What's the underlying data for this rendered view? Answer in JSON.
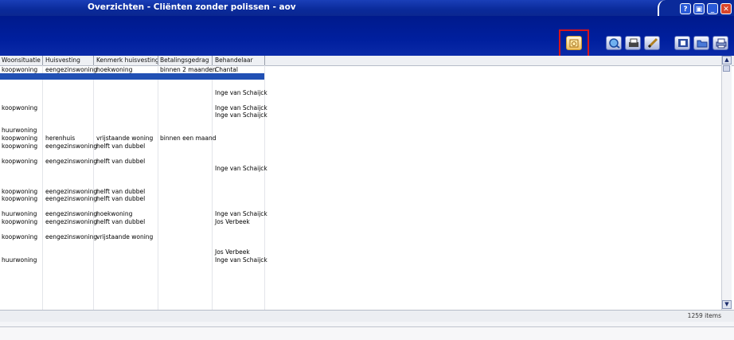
{
  "window": {
    "title": "Overzichten - Cliënten zonder polissen - aov",
    "buttons": {
      "help": "?",
      "restore": "▣",
      "minimize": "_",
      "close": "✕"
    }
  },
  "toolbar": {
    "buttons": [
      {
        "name": "calendar-button",
        "icon": "calendar-icon"
      },
      {
        "name": "search-button",
        "icon": "search-icon"
      },
      {
        "name": "print-preview-button",
        "icon": "print-preview-icon"
      },
      {
        "name": "edit-button",
        "icon": "pencil-icon"
      },
      {
        "name": "export-button",
        "icon": "export-icon"
      },
      {
        "name": "open-button",
        "icon": "folder-icon"
      },
      {
        "name": "print-button",
        "icon": "printer-icon"
      }
    ],
    "highlight_color": "#d8141a"
  },
  "table": {
    "columns": [
      "Woonsituatie",
      "Huisvesting",
      "Kenmerk huisvesting",
      "Betalingsgedrag",
      "Behandelaar"
    ],
    "rows": [
      [
        "koopwoning",
        "eengezinswoning",
        "hoekwoning",
        "binnen 2 maanden",
        "Chantal"
      ],
      [
        "",
        "",
        "",
        "",
        ""
      ],
      [
        "",
        "",
        "",
        "",
        ""
      ],
      [
        "",
        "",
        "",
        "",
        "Inge van Schaijck"
      ],
      [
        "",
        "",
        "",
        "",
        ""
      ],
      [
        "koopwoning",
        "",
        "",
        "",
        "Inge van Schaijck"
      ],
      [
        "",
        "",
        "",
        "",
        "Inge van Schaijck"
      ],
      [
        "",
        "",
        "",
        "",
        ""
      ],
      [
        "huurwoning",
        "",
        "",
        "",
        ""
      ],
      [
        "koopwoning",
        "herenhuis",
        "vrijstaande woning",
        "binnen een maand",
        ""
      ],
      [
        "koopwoning",
        "eengezinswoning",
        "helft van dubbel",
        "",
        ""
      ],
      [
        "",
        "",
        "",
        "",
        ""
      ],
      [
        "koopwoning",
        "eengezinswoning",
        "helft van dubbel",
        "",
        ""
      ],
      [
        "",
        "",
        "",
        "",
        "Inge van Schaijck"
      ],
      [
        "",
        "",
        "",
        "",
        ""
      ],
      [
        "",
        "",
        "",
        "",
        ""
      ],
      [
        "koopwoning",
        "eengezinswoning",
        "helft van dubbel",
        "",
        ""
      ],
      [
        "koopwoning",
        "eengezinswoning",
        "helft van dubbel",
        "",
        ""
      ],
      [
        "",
        "",
        "",
        "",
        ""
      ],
      [
        "huurwoning",
        "eengezinswoning",
        "hoekwoning",
        "",
        "Inge van Schaijck"
      ],
      [
        "koopwoning",
        "eengezinswoning",
        "helft van dubbel",
        "",
        "Jos Verbeek"
      ],
      [
        "",
        "",
        "",
        "",
        ""
      ],
      [
        "koopwoning",
        "eengezinswoning",
        "vrijstaande woning",
        "",
        ""
      ],
      [
        "",
        "",
        "",
        "",
        ""
      ],
      [
        "",
        "",
        "",
        "",
        "Jos Verbeek"
      ],
      [
        "huurwoning",
        "",
        "",
        "",
        "Inge van Schaijck"
      ]
    ]
  },
  "status": {
    "items": "1259 items"
  }
}
